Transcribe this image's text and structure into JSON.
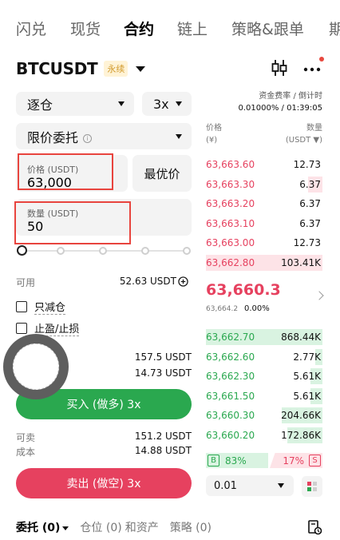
{
  "nav": {
    "tabs": [
      "闪兑",
      "现货",
      "合约",
      "链上",
      "策略&跟单",
      "期"
    ],
    "active_index": 2
  },
  "header": {
    "pair": "BTCUSDT",
    "badge": "永续",
    "icons": [
      "candlestick-chart-icon",
      "more-icon"
    ]
  },
  "funding": {
    "label": "资金费率 / 倒计时",
    "value": "0.01000% / 01:39:05"
  },
  "form": {
    "margin_mode": "逐仓",
    "leverage": "3x",
    "order_type": "限价委托",
    "price_label": "价格 (USDT)",
    "price_value": "63,000",
    "best_price_button": "最优价",
    "qty_label": "数量 (USDT)",
    "qty_value": "50",
    "slider_level": 0,
    "available_label": "可用",
    "available_value": "52.63 USDT",
    "reduce_only": "只减仓",
    "tp_sl": "止盈/止损",
    "buy_value_1": "157.5 USDT",
    "buy_value_2": "14.73 USDT",
    "buy_button": "买入 (做多) 3x",
    "sellable_label": "可卖",
    "sellable_value": "151.2 USDT",
    "cost_label": "成本",
    "cost_value": "14.88 USDT",
    "sell_button": "卖出 (做空) 3x"
  },
  "orderbook": {
    "price_header": "价格",
    "price_unit": "(¥)",
    "qty_header": "数量",
    "qty_unit": "(USDT ▼)",
    "asks": [
      {
        "price": "63,663.60",
        "qty": "12.73",
        "depth": 0.0
      },
      {
        "price": "63,663.30",
        "qty": "6.37",
        "depth": 0.12
      },
      {
        "price": "63,663.20",
        "qty": "6.37",
        "depth": 0.0
      },
      {
        "price": "63,663.10",
        "qty": "6.37",
        "depth": 0.0
      },
      {
        "price": "63,663.00",
        "qty": "12.73",
        "depth": 0.0
      },
      {
        "price": "63,662.80",
        "qty": "103.41K",
        "depth": 1.0
      }
    ],
    "last_price": "63,660.3",
    "mark_price": "63,664.2",
    "change_pct": "0.00%",
    "bids": [
      {
        "price": "63,662.70",
        "qty": "868.44K",
        "depth": 1.0
      },
      {
        "price": "63,662.60",
        "qty": "2.77K",
        "depth": 0.06
      },
      {
        "price": "63,662.30",
        "qty": "5.61K",
        "depth": 0.1
      },
      {
        "price": "63,661.50",
        "qty": "5.61K",
        "depth": 0.1
      },
      {
        "price": "63,660.30",
        "qty": "204.66K",
        "depth": 0.35
      },
      {
        "price": "63,660.20",
        "qty": "172.86K",
        "depth": 0.3
      }
    ],
    "buy_tag": "B",
    "buy_pct": "83%",
    "sell_pct": "17%",
    "sell_tag": "S",
    "precision": "0.01"
  },
  "bottom": {
    "tabs": [
      "委托 (0)",
      "仓位 (0)",
      "和资产",
      "策略 (0)"
    ]
  },
  "colors": {
    "buy": "#2aa84f",
    "sell": "#e6415f",
    "highlight": "#e8443e",
    "badge_text": "#d29a2c"
  }
}
